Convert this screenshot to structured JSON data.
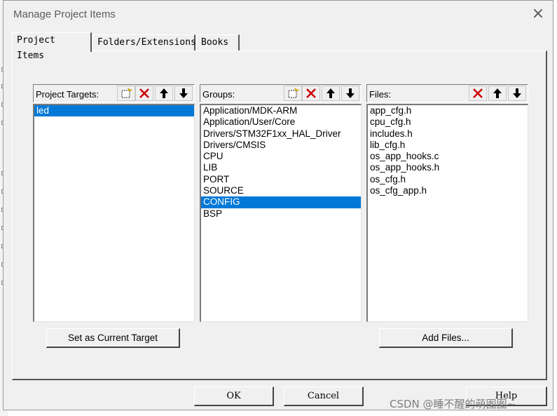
{
  "window": {
    "title": "Manage Project Items",
    "close_glyph": "×"
  },
  "tabs": [
    {
      "label": "Project Items",
      "active": true
    },
    {
      "label": "Folders/Extensions",
      "active": false
    },
    {
      "label": "Books",
      "active": false
    }
  ],
  "targets": {
    "label": "Project Targets:",
    "items": [
      "led"
    ],
    "selected": "led",
    "toolbar": [
      "new-icon",
      "delete-icon",
      "move-up-icon",
      "move-down-icon"
    ],
    "button": "Set as Current Target"
  },
  "groups": {
    "label": "Groups:",
    "items": [
      "Application/MDK-ARM",
      "Application/User/Core",
      "Drivers/STM32F1xx_HAL_Driver",
      "Drivers/CMSIS",
      "CPU",
      "LIB",
      "PORT",
      "SOURCE",
      "CONFIG",
      "BSP"
    ],
    "selected": "CONFIG",
    "toolbar": [
      "new-icon",
      "delete-icon",
      "move-up-icon",
      "move-down-icon"
    ]
  },
  "files": {
    "label": "Files:",
    "items": [
      "app_cfg.h",
      "cpu_cfg.h",
      "includes.h",
      "lib_cfg.h",
      "os_app_hooks.c",
      "os_app_hooks.h",
      "os_cfg.h",
      "os_cfg_app.h"
    ],
    "toolbar": [
      "delete-icon",
      "move-up-icon",
      "move-down-icon"
    ],
    "button": "Add Files..."
  },
  "dialog_buttons": {
    "ok": "OK",
    "cancel": "Cancel",
    "help": "Help"
  },
  "watermark": "CSDN @睡不醒的萌图图~",
  "colors": {
    "selection": "#0078d7",
    "delete_red": "#cc0000",
    "dialog_bg": "#f0f0f0"
  }
}
